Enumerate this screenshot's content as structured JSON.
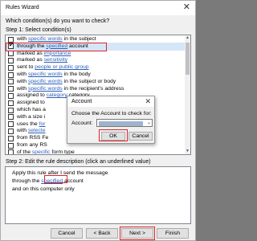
{
  "wizard": {
    "title": "Rules Wizard",
    "close_glyph": "✕",
    "question": "Which condition(s) do you want to check?",
    "step1": "Step 1: Select condition(s)",
    "step2": "Step 2: Edit the rule description (click an underlined value)"
  },
  "conditions": [
    {
      "pre": "with ",
      "link": "specific words",
      "post": " in the subject",
      "checked": false,
      "selected": false
    },
    {
      "pre": "through the ",
      "link": "specified",
      "post": " account",
      "checked": true,
      "selected": true
    },
    {
      "pre": "marked as ",
      "link": "importance",
      "post": "",
      "checked": false,
      "selected": false
    },
    {
      "pre": "marked as ",
      "link": "sensitivity",
      "post": "",
      "checked": false,
      "selected": false
    },
    {
      "pre": "sent to ",
      "link": "people or public group",
      "post": "",
      "checked": false,
      "selected": false
    },
    {
      "pre": "with ",
      "link": "specific words",
      "post": " in the body",
      "checked": false,
      "selected": false
    },
    {
      "pre": "with ",
      "link": "specific words",
      "post": " in the subject or body",
      "checked": false,
      "selected": false
    },
    {
      "pre": "with ",
      "link": "specific words",
      "post": " in the recipient's address",
      "checked": false,
      "selected": false
    },
    {
      "pre": "assigned to ",
      "link": "category",
      "post": " category",
      "checked": false,
      "selected": false
    },
    {
      "pre": "assigned to ",
      "link": "",
      "post": "",
      "checked": false,
      "selected": false
    },
    {
      "pre": "which has a",
      "link": "",
      "post": "",
      "checked": false,
      "selected": false
    },
    {
      "pre": "with a size i",
      "link": "",
      "post": "",
      "checked": false,
      "selected": false
    },
    {
      "pre": "uses the ",
      "link": "for",
      "post": "",
      "checked": false,
      "selected": false
    },
    {
      "pre": "with ",
      "link": "selecte",
      "post": "",
      "checked": false,
      "selected": false
    },
    {
      "pre": "from RSS Fe",
      "link": "",
      "post": "",
      "checked": false,
      "selected": false
    },
    {
      "pre": "from any RS",
      "link": "",
      "post": "",
      "checked": false,
      "selected": false
    },
    {
      "pre": "of the ",
      "link": "specific",
      "post": " form type",
      "checked": false,
      "selected": false
    }
  ],
  "description": {
    "line1": "Apply this rule after I send the message",
    "line2_pre": "through the ",
    "line2_link": "specified",
    "line2_post": " account",
    "line3": "and on this computer only"
  },
  "buttons": {
    "cancel": "Cancel",
    "back": "< Back",
    "next": "Next >",
    "finish": "Finish"
  },
  "account_dialog": {
    "title": "Account",
    "close_glyph": "✕",
    "choose": "Choose the Account to check for:",
    "label": "Account:",
    "ok": "OK",
    "cancel": "Cancel",
    "dropdown_glyph": "⌄"
  },
  "colors": {
    "highlight": "#d9262b",
    "link": "#2b5fb8",
    "selected_row": "#d5e6f7"
  }
}
